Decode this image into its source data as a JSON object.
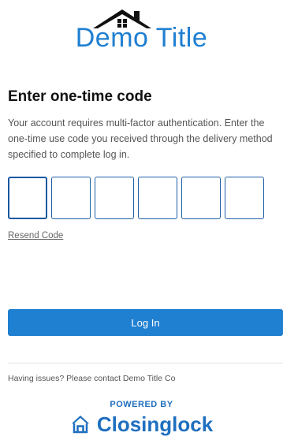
{
  "header": {
    "logo_title": "Demo Title"
  },
  "page": {
    "heading": "Enter one-time code",
    "description": "Your account requires multi-factor authentication. Enter the one-time use code you received through the delivery method specified to complete log in."
  },
  "otp": {
    "box_count": 6,
    "values": [
      "",
      "",
      "",
      "",
      "",
      ""
    ]
  },
  "actions": {
    "resend_label": "Resend Code",
    "login_label": "Log In"
  },
  "footer": {
    "issues_text": "Having issues? Please contact Demo Title Co",
    "powered_by": "POWERED BY",
    "brand_name": "Closinglock",
    "brand_icon": "house-icon"
  },
  "colors": {
    "accent": "#1f7fd1",
    "brand": "#1f6fbf",
    "box_border": "#1f5fa8"
  }
}
